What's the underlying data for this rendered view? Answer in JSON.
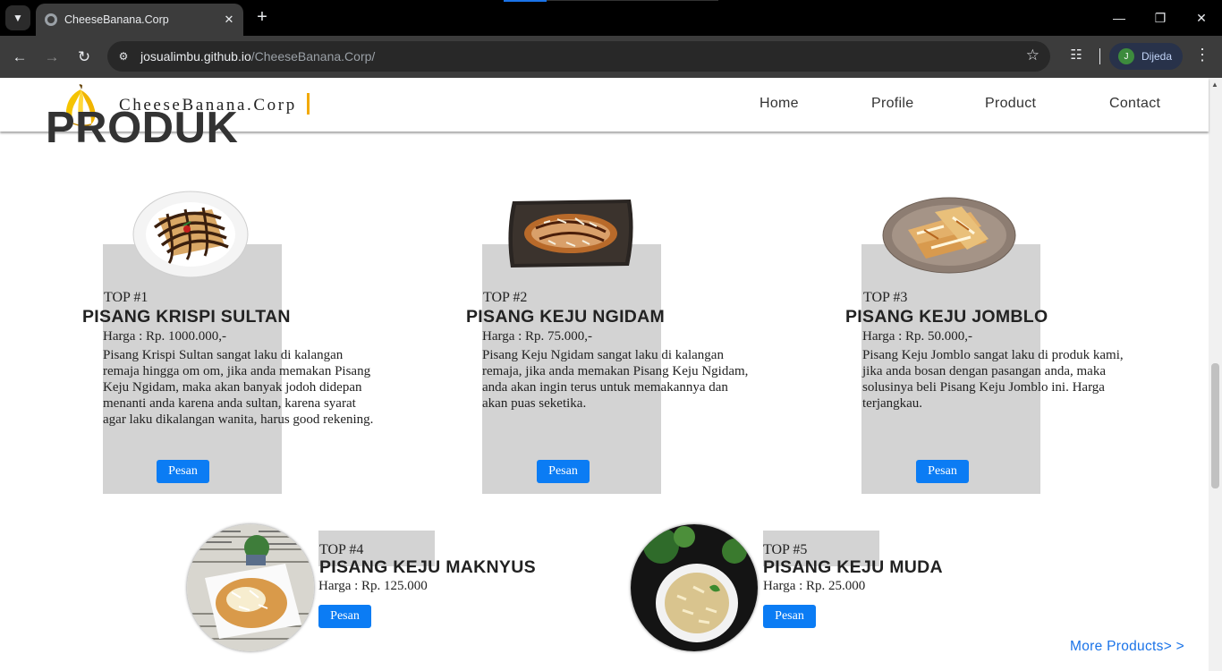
{
  "browser": {
    "tab_title": "CheeseBanana.Corp",
    "url_host": "josualimbu.github.io",
    "url_path": "/CheeseBanana.Corp/",
    "profile_initial": "J",
    "profile_name": "Dijeda"
  },
  "site": {
    "brand": "CheeseBanana.Corp",
    "nav": [
      "Home",
      "Profile",
      "Product",
      "Contact"
    ],
    "section_title": "PRODUK",
    "more_link": "More Products> >"
  },
  "products": [
    {
      "top": "TOP #1",
      "name": "PISANG KRISPI SULTAN",
      "price": "Harga : Rp. 1000.000,-",
      "desc": "Pisang Krispi Sultan sangat laku di kalangan remaja hingga om om, jika anda memakan Pisang Keju Ngidam, maka akan banyak jodoh didepan menanti anda karena anda sultan, karena syarat agar laku dikalangan wanita, harus good rekening.",
      "button": "Pesan"
    },
    {
      "top": "TOP #2",
      "name": "PISANG KEJU NGIDAM",
      "price": "Harga : Rp. 75.000,-",
      "desc": "Pisang Keju Ngidam sangat laku di kalangan remaja, jika anda memakan Pisang Keju Ngidam, anda akan ingin terus untuk memakannya dan akan puas seketika.",
      "button": "Pesan"
    },
    {
      "top": "TOP #3",
      "name": "PISANG KEJU JOMBLO",
      "price": "Harga : Rp. 50.000,-",
      "desc": "Pisang Keju Jomblo sangat laku di produk kami, jika anda bosan dengan pasangan anda, maka solusinya beli Pisang Keju Jomblo ini. Harga terjangkau.",
      "button": "Pesan"
    },
    {
      "top": "TOP #4",
      "name": "PISANG KEJU MAKNYUS",
      "price": "Harga : Rp. 125.000",
      "button": "Pesan"
    },
    {
      "top": "TOP #5",
      "name": "PISANG KEJU MUDA",
      "price": "Harga : Rp. 25.000",
      "button": "Pesan"
    }
  ],
  "colors": {
    "button_blue": "#0b7cf4",
    "card_gray": "#d3d3d3",
    "brand_yellow": "#f2a900",
    "link_blue": "#1a73e8"
  }
}
